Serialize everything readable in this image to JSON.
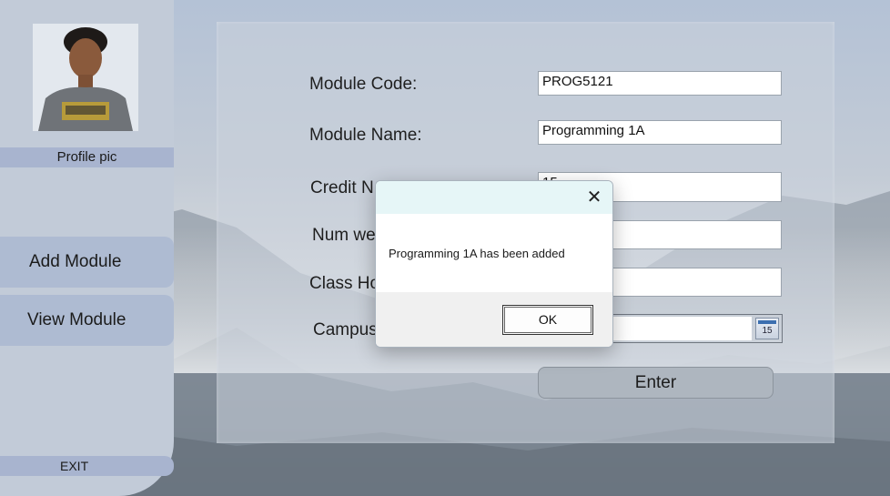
{
  "sidebar": {
    "profile_label": "Profile pic",
    "nav": [
      {
        "label": "Add Module"
      },
      {
        "label": "View Module"
      }
    ],
    "exit_label": "EXIT"
  },
  "form": {
    "fields": [
      {
        "label": "Module Code:",
        "value": "PROG5121"
      },
      {
        "label": "Module Name:",
        "value": "Programming 1A"
      },
      {
        "label": "Credit N",
        "value": "15"
      },
      {
        "label": "Num we",
        "value": ""
      },
      {
        "label": "Class Ho",
        "value": ""
      },
      {
        "label": "Campus",
        "value": ""
      }
    ],
    "calendar_icon_text": "15",
    "enter_label": "Enter"
  },
  "dialog": {
    "close_glyph": "✕",
    "message": "Programming 1A has been added",
    "ok_label": "OK"
  },
  "colors": {
    "sidebar_bg": "#c2cbd8",
    "nav_button_bg": "#aebbd2",
    "dialog_title_bg": "#e6f6f7"
  }
}
